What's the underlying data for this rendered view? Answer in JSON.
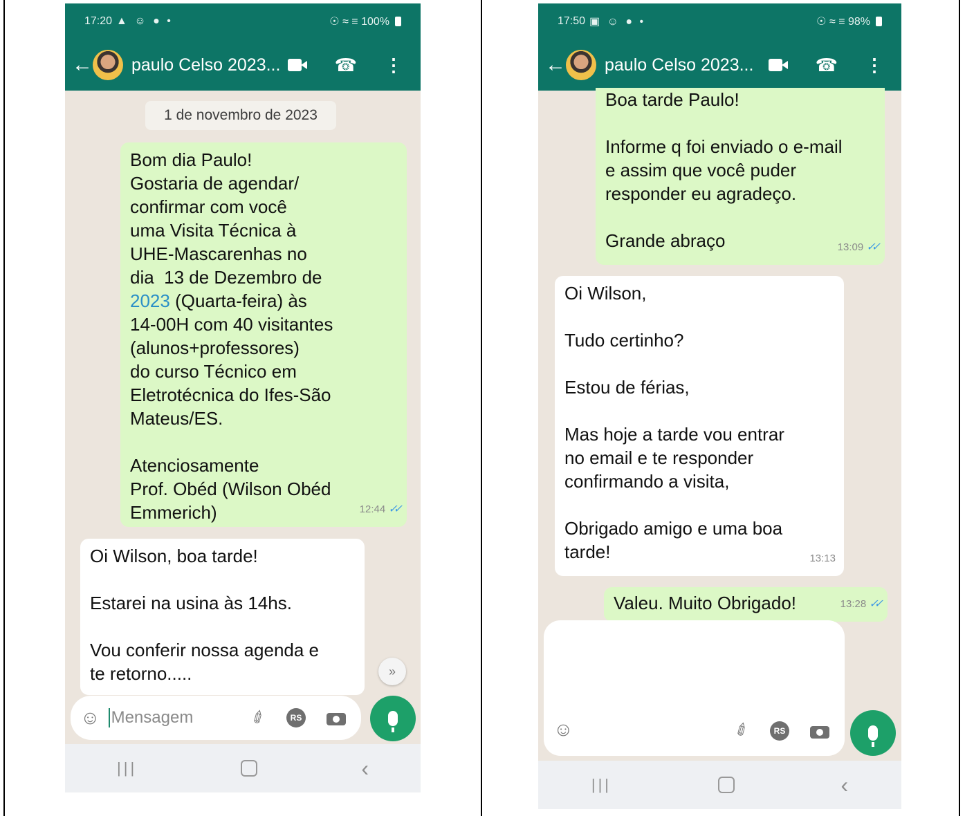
{
  "left": {
    "status": {
      "time": "17:20",
      "left_glyphs": "▲ ☺ ● •",
      "right_text": "☉ ≈ ≡ 100%"
    },
    "header": {
      "contact": "paulo Celso 2023..."
    },
    "date_chip": "1 de novembro de 2023",
    "messages": [
      {
        "text_before": "Bom dia Paulo!\nGostaria de agendar/\nconfirmar com você\numa Visita Técnica à\nUHE-Mascarenhas no\ndia  13 de Dezembro de\n",
        "link": "2023",
        "text_after": " (Quarta-feira) às\n14-00H com 40 visitantes\n(alunos+professores)\ndo curso Técnico em\nEletrotécnica do Ifes-São\nMateus/ES.\n\nAtenciosamente\nProf. Obéd (Wilson Obéd\nEmmerich)",
        "time": "12:44"
      },
      {
        "text": "Oi Wilson, boa tarde!\n\nEstarei na usina às 14hs.\n\nVou conferir nossa agenda e\nte retorno....."
      }
    ],
    "composer": {
      "placeholder": "Mensagem",
      "rs_label": "RS"
    }
  },
  "right": {
    "status": {
      "time": "17:50",
      "left_glyphs": "▣ ☺ ● •",
      "right_text": "☉ ≈ ≡ 98%"
    },
    "header": {
      "contact": "paulo Celso 2023..."
    },
    "messages": [
      {
        "text": "Boa tarde Paulo!\n\nInforme q foi enviado o e-mail\ne assim que você puder\nresponder eu agradeço.\n\nGrande abraço",
        "time": "13:09"
      },
      {
        "text": "Oi Wilson,\n\nTudo certinho?\n\nEstou de férias,\n\nMas hoje a tarde vou entrar\nno email e te responder\nconfirmando a visita,\n\nObrigado amigo e uma boa\ntarde!",
        "time": "13:13"
      },
      {
        "text": "Valeu. Muito Obrigado!",
        "time": "13:28"
      }
    ],
    "composer": {
      "rs_label": "RS"
    }
  },
  "icons": {
    "ticks": "✓✓",
    "back": "←",
    "call": "☎",
    "menu": "⋮",
    "emoji": "☺",
    "clip": "✐",
    "scroll_down": "»",
    "nav_recent": "|||",
    "nav_back": "‹"
  },
  "colors": {
    "header": "#0d7566",
    "outgoing_bubble": "#dcf8c6",
    "incoming_bubble": "#ffffff",
    "chat_bg": "#ece5dd",
    "mic_button": "#1da069",
    "read_ticks": "#3b97e6"
  }
}
